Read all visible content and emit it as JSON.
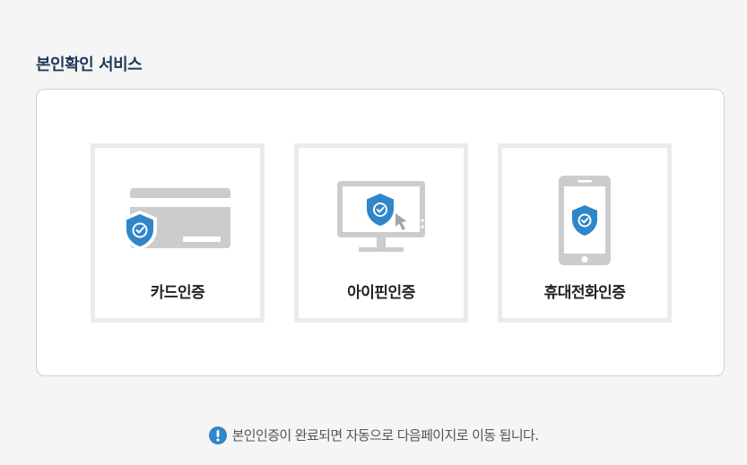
{
  "section": {
    "title": "본인확인 서비스"
  },
  "methods": [
    {
      "label": "카드인증",
      "icon": "credit-card-shield-icon"
    },
    {
      "label": "아이핀인증",
      "icon": "monitor-shield-icon"
    },
    {
      "label": "휴대전화인증",
      "icon": "mobile-phone-shield-icon"
    }
  ],
  "notice": {
    "icon": "exclamation-circle-icon",
    "text": "본인인증이 완료되면 자동으로 다음페이지로 이동 됩니다."
  },
  "colors": {
    "title": "#1f3a5a",
    "accent_blue": "#2f86c8",
    "icon_gray": "#cccccc",
    "card_border": "#ebebeb"
  }
}
